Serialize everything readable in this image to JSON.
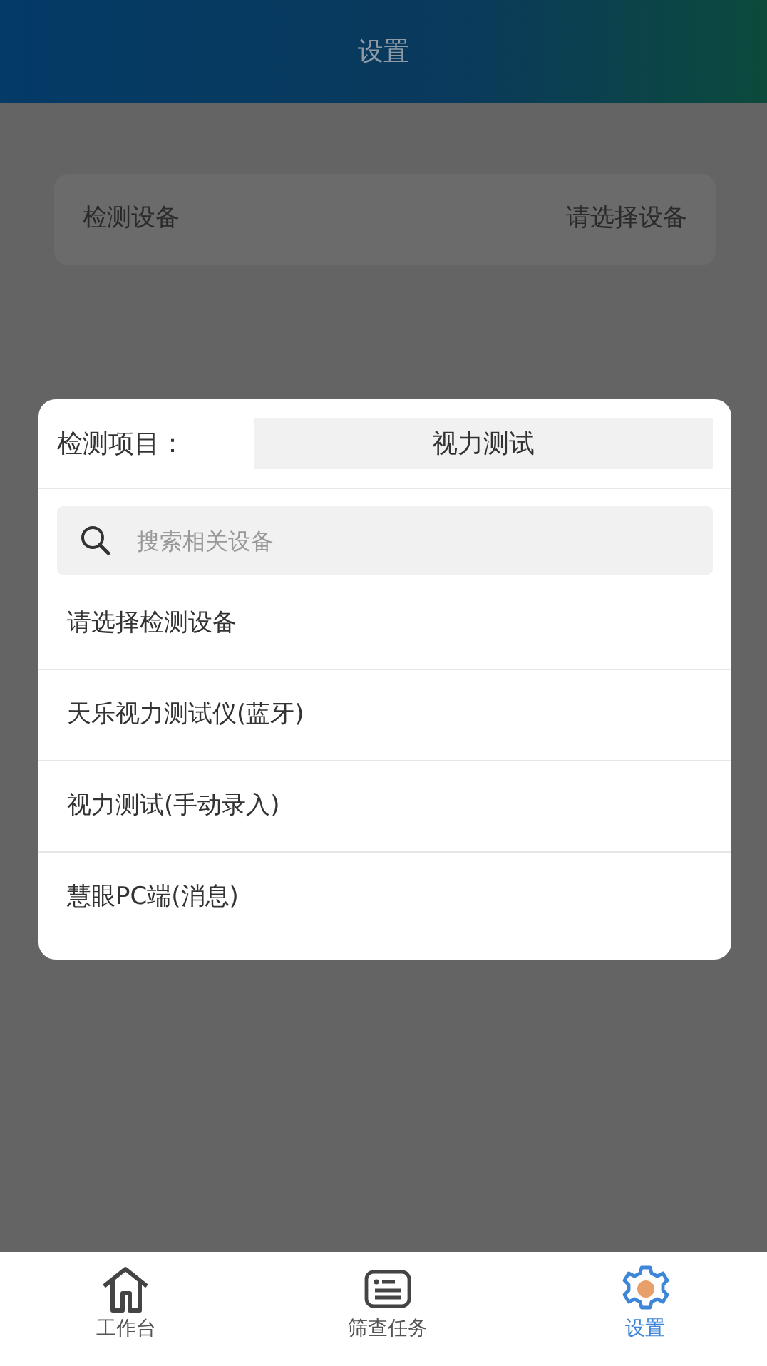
{
  "header": {
    "title": "设置"
  },
  "settings": [
    {
      "label": "检测设备",
      "value": "请选择设备"
    }
  ],
  "dialog": {
    "project_label": "检测项目：",
    "project_value": "视力测试",
    "search": {
      "placeholder": "搜索相关设备"
    },
    "options": [
      {
        "label": "请选择检测设备"
      },
      {
        "label": "天乐视力测试仪(蓝牙)"
      },
      {
        "label": "视力测试(手动录入)"
      },
      {
        "label": "慧眼PC端(消息)"
      }
    ]
  },
  "tabbar": [
    {
      "label": "工作台",
      "kind": "home",
      "selected": false
    },
    {
      "label": "筛查任务",
      "kind": "list",
      "selected": false
    },
    {
      "label": "设置",
      "kind": "gear",
      "selected": true
    }
  ]
}
